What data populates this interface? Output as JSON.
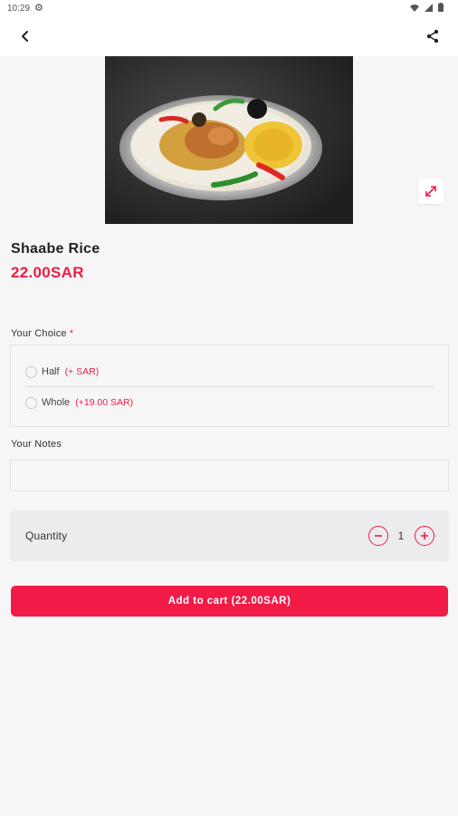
{
  "status_bar": {
    "time": "10:29"
  },
  "product": {
    "name": "Shaabe Rice",
    "price": "22.00SAR"
  },
  "choice": {
    "label": "Your Choice",
    "required_marker": "*",
    "options": [
      {
        "label": "Half",
        "extra": "(+ SAR)",
        "selected": false
      },
      {
        "label": "Whole",
        "extra": "(+19.00 SAR)",
        "selected": false
      }
    ]
  },
  "notes": {
    "label": "Your Notes",
    "value": "",
    "placeholder": ""
  },
  "quantity": {
    "label": "Quantity",
    "value": "1"
  },
  "cart_button": {
    "label": "Add to cart (22.00SAR)"
  },
  "colors": {
    "accent": "#f21b47",
    "background": "#f6f6f6"
  },
  "icons": {
    "back": "arrow-left-icon",
    "share": "share-icon",
    "expand": "expand-icon",
    "minus": "minus-circle-icon",
    "plus": "plus-circle-icon"
  }
}
